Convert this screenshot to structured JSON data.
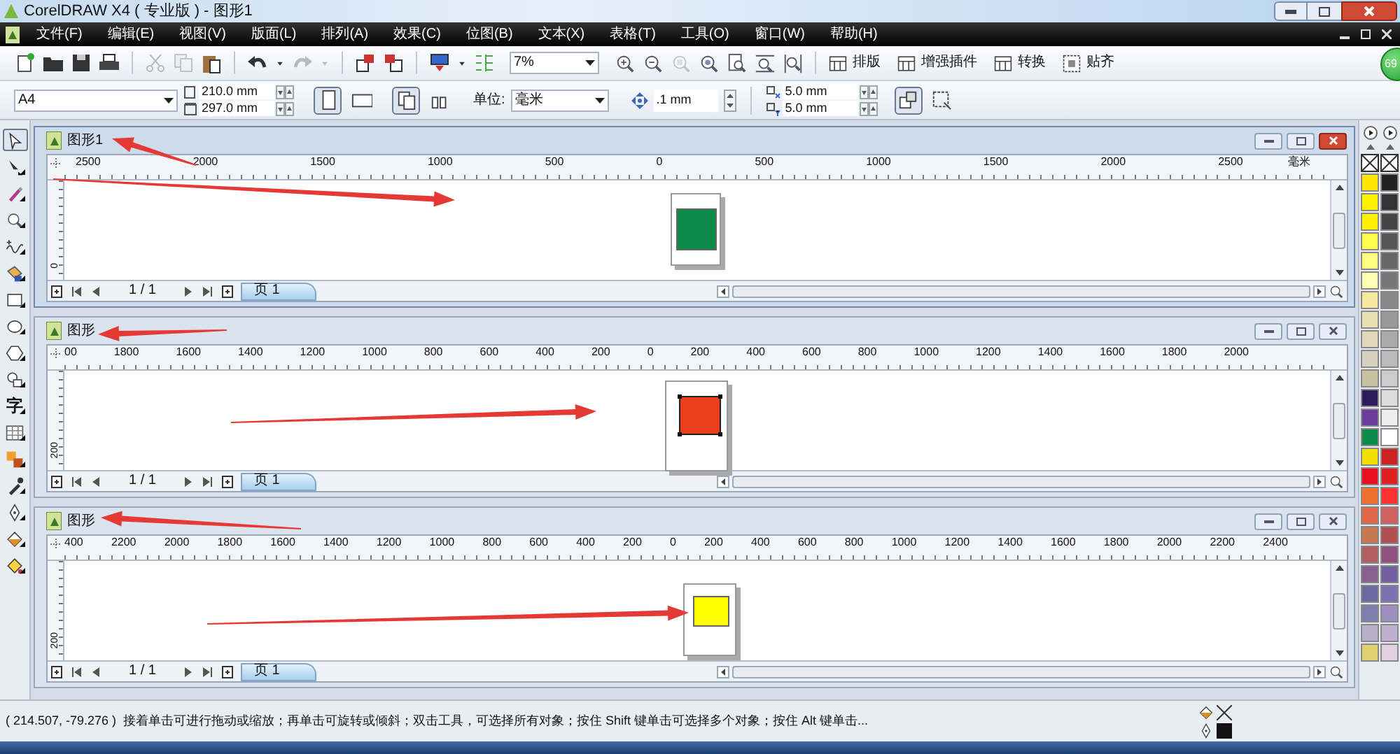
{
  "title_bar": {
    "title": "CorelDRAW X4 ( 专业版 ) - 图形1"
  },
  "menu": [
    "文件(F)",
    "编辑(E)",
    "视图(V)",
    "版面(L)",
    "排列(A)",
    "效果(C)",
    "位图(B)",
    "文本(X)",
    "表格(T)",
    "工具(O)",
    "窗口(W)",
    "帮助(H)"
  ],
  "toolbar": {
    "tools": [
      {
        "kind": "new",
        "disabled": false
      },
      {
        "kind": "open",
        "disabled": false
      },
      {
        "kind": "save",
        "disabled": false
      },
      {
        "kind": "print",
        "disabled": false
      },
      {
        "kind": "sep"
      },
      {
        "kind": "cut",
        "disabled": true
      },
      {
        "kind": "copy",
        "disabled": true
      },
      {
        "kind": "paste",
        "disabled": false
      },
      {
        "kind": "sep"
      },
      {
        "kind": "undo",
        "disabled": false
      },
      {
        "kind": "caret",
        "disabled": false
      },
      {
        "kind": "redo",
        "disabled": true
      },
      {
        "kind": "caret",
        "disabled": true
      },
      {
        "kind": "sep"
      },
      {
        "kind": "import",
        "disabled": false
      },
      {
        "kind": "export",
        "disabled": false
      },
      {
        "kind": "sep"
      },
      {
        "kind": "publish",
        "disabled": false
      },
      {
        "kind": "caret",
        "disabled": false
      },
      {
        "kind": "options",
        "disabled": false
      }
    ],
    "zoom": "7%",
    "zoom_tools": [
      {
        "kind": "zoomin",
        "disabled": false
      },
      {
        "kind": "zoomout",
        "disabled": false
      },
      {
        "kind": "zoomsel",
        "disabled": true
      },
      {
        "kind": "zoomall",
        "disabled": false
      },
      {
        "kind": "zoompage",
        "disabled": false
      },
      {
        "kind": "zoomwidth",
        "disabled": false
      },
      {
        "kind": "zoomheight",
        "disabled": false
      }
    ],
    "buttons": [
      {
        "label": "排版",
        "kind": "layout"
      },
      {
        "label": "增强插件",
        "kind": "layout"
      },
      {
        "label": "转换",
        "kind": "layout"
      },
      {
        "label": "贴齐",
        "kind": "grid"
      }
    ]
  },
  "property_bar": {
    "page_size": "A4",
    "width": "210.0 mm",
    "height": "297.0 mm",
    "orientation": [
      {
        "kind": "portrait",
        "selected": true
      },
      {
        "kind": "landscape",
        "selected": false
      }
    ],
    "page_scope": [
      {
        "kind": "all",
        "selected": true
      },
      {
        "kind": "current",
        "selected": false
      }
    ],
    "unit_label": "单位:",
    "unit": "毫米",
    "nudge": ".1 mm",
    "duplicate_x": "5.0 mm",
    "duplicate_y": "5.0 mm",
    "tools": [
      {
        "kind": "treat",
        "selected": true
      },
      {
        "kind": "edges",
        "selected": false
      }
    ]
  },
  "badge": "69",
  "toolbox": [
    {
      "kind": "pointer",
      "selected": true
    },
    {
      "kind": "shape",
      "selected": false
    },
    {
      "kind": "crop",
      "selected": false
    },
    {
      "kind": "zoom",
      "selected": false
    },
    {
      "kind": "freehand",
      "selected": false
    },
    {
      "kind": "smartfill",
      "selected": false
    },
    {
      "kind": "rectangle",
      "selected": false
    },
    {
      "kind": "ellipse",
      "selected": false
    },
    {
      "kind": "polygon",
      "selected": false
    },
    {
      "kind": "basic",
      "selected": false
    },
    {
      "kind": "text",
      "label": "字",
      "selected": false
    },
    {
      "kind": "table",
      "selected": false
    },
    {
      "kind": "blend",
      "selected": false
    },
    {
      "kind": "eyedropper",
      "selected": false
    },
    {
      "kind": "outline",
      "selected": false
    },
    {
      "kind": "fill",
      "selected": false
    },
    {
      "kind": "interactive",
      "selected": false
    }
  ],
  "windows": [
    {
      "title": "图形1",
      "active": true,
      "ruler_labels": [
        "2500",
        "2000",
        "1500",
        "1000",
        "500",
        "0",
        "500",
        "1000",
        "1500",
        "2000",
        "2500"
      ],
      "ruler_unit": "毫米",
      "vertical_label": "0",
      "shape": {
        "color": "#0a8c48",
        "selected": false
      },
      "page_counter": "1 / 1",
      "page_tab": "页 1"
    },
    {
      "title": "图形",
      "active": false,
      "ruler_labels": [
        "00",
        "1800",
        "1600",
        "1400",
        "1200",
        "1000",
        "800",
        "600",
        "400",
        "200",
        "0",
        "200",
        "400",
        "600",
        "800",
        "1000",
        "1200",
        "1400",
        "1600",
        "1800",
        "2000"
      ],
      "vertical_label": "200",
      "shape": {
        "color": "#e8401a",
        "selected": true
      },
      "page_counter": "1 / 1",
      "page_tab": "页 1"
    },
    {
      "title": "图形",
      "active": false,
      "ruler_labels": [
        "400",
        "2200",
        "2000",
        "1800",
        "1600",
        "1400",
        "1200",
        "1000",
        "800",
        "600",
        "400",
        "200",
        "0",
        "200",
        "400",
        "600",
        "800",
        "1000",
        "1200",
        "1400",
        "1600",
        "1800",
        "2000",
        "2200",
        "2400"
      ],
      "vertical_label": "200",
      "shape": {
        "color": "#ffff00",
        "selected": false
      },
      "page_counter": "1 / 1",
      "page_tab": "页 1"
    }
  ],
  "palette": {
    "columns": [
      [
        {
          "color": "#ffe600"
        },
        {
          "color": "#fff200"
        },
        {
          "color": "#fff200"
        },
        {
          "color": "#ffff4d"
        },
        {
          "color": "#ffff80"
        },
        {
          "color": "#ffffb3"
        },
        {
          "color": "#f5e6a0"
        },
        {
          "color": "#e8e0b0"
        },
        {
          "color": "#e0d8b8"
        },
        {
          "color": "#d8d0c0"
        },
        {
          "color": "#c8c0a0"
        },
        {
          "color": "#2d1b5e"
        },
        {
          "color": "#6a3d9a"
        },
        {
          "color": "#0a8c48"
        },
        {
          "color": "#f0e000"
        },
        {
          "color": "#e8101e"
        },
        {
          "color": "#f07030"
        },
        {
          "color": "#e06848"
        },
        {
          "color": "#c87850"
        },
        {
          "color": "#b06060"
        },
        {
          "color": "#8a6090"
        },
        {
          "color": "#6a6aa0"
        },
        {
          "color": "#8080b0"
        },
        {
          "color": "#b8b0c8"
        },
        {
          "color": "#e0d070"
        }
      ],
      [
        {
          "color": "#222222"
        },
        {
          "color": "#333333"
        },
        {
          "color": "#444444"
        },
        {
          "color": "#555555"
        },
        {
          "color": "#666666"
        },
        {
          "color": "#777777"
        },
        {
          "color": "#888888"
        },
        {
          "color": "#999999"
        },
        {
          "color": "#aaaaaa"
        },
        {
          "color": "#bbbbbb"
        },
        {
          "color": "#cccccc"
        },
        {
          "color": "#dddddd"
        },
        {
          "color": "#eeeeee"
        },
        {
          "color": "#ffffff"
        },
        {
          "color": "#cc2222"
        },
        {
          "color": "#e02020"
        },
        {
          "color": "#ff3030"
        },
        {
          "color": "#d06060"
        },
        {
          "color": "#b05050"
        },
        {
          "color": "#905080"
        },
        {
          "color": "#7060a0"
        },
        {
          "color": "#8070b0"
        },
        {
          "color": "#a090c0"
        },
        {
          "color": "#c0b0d0"
        },
        {
          "color": "#e0d0e0"
        }
      ]
    ]
  },
  "status_bar": {
    "coordinates": "( 214.507, -79.276 )",
    "hint": "接着单击可进行拖动或缩放；再单击可旋转或倾斜；双击工具，可选择所有对象；按住 Shift 键单击可选择多个对象；按住 Alt 键单击..."
  }
}
